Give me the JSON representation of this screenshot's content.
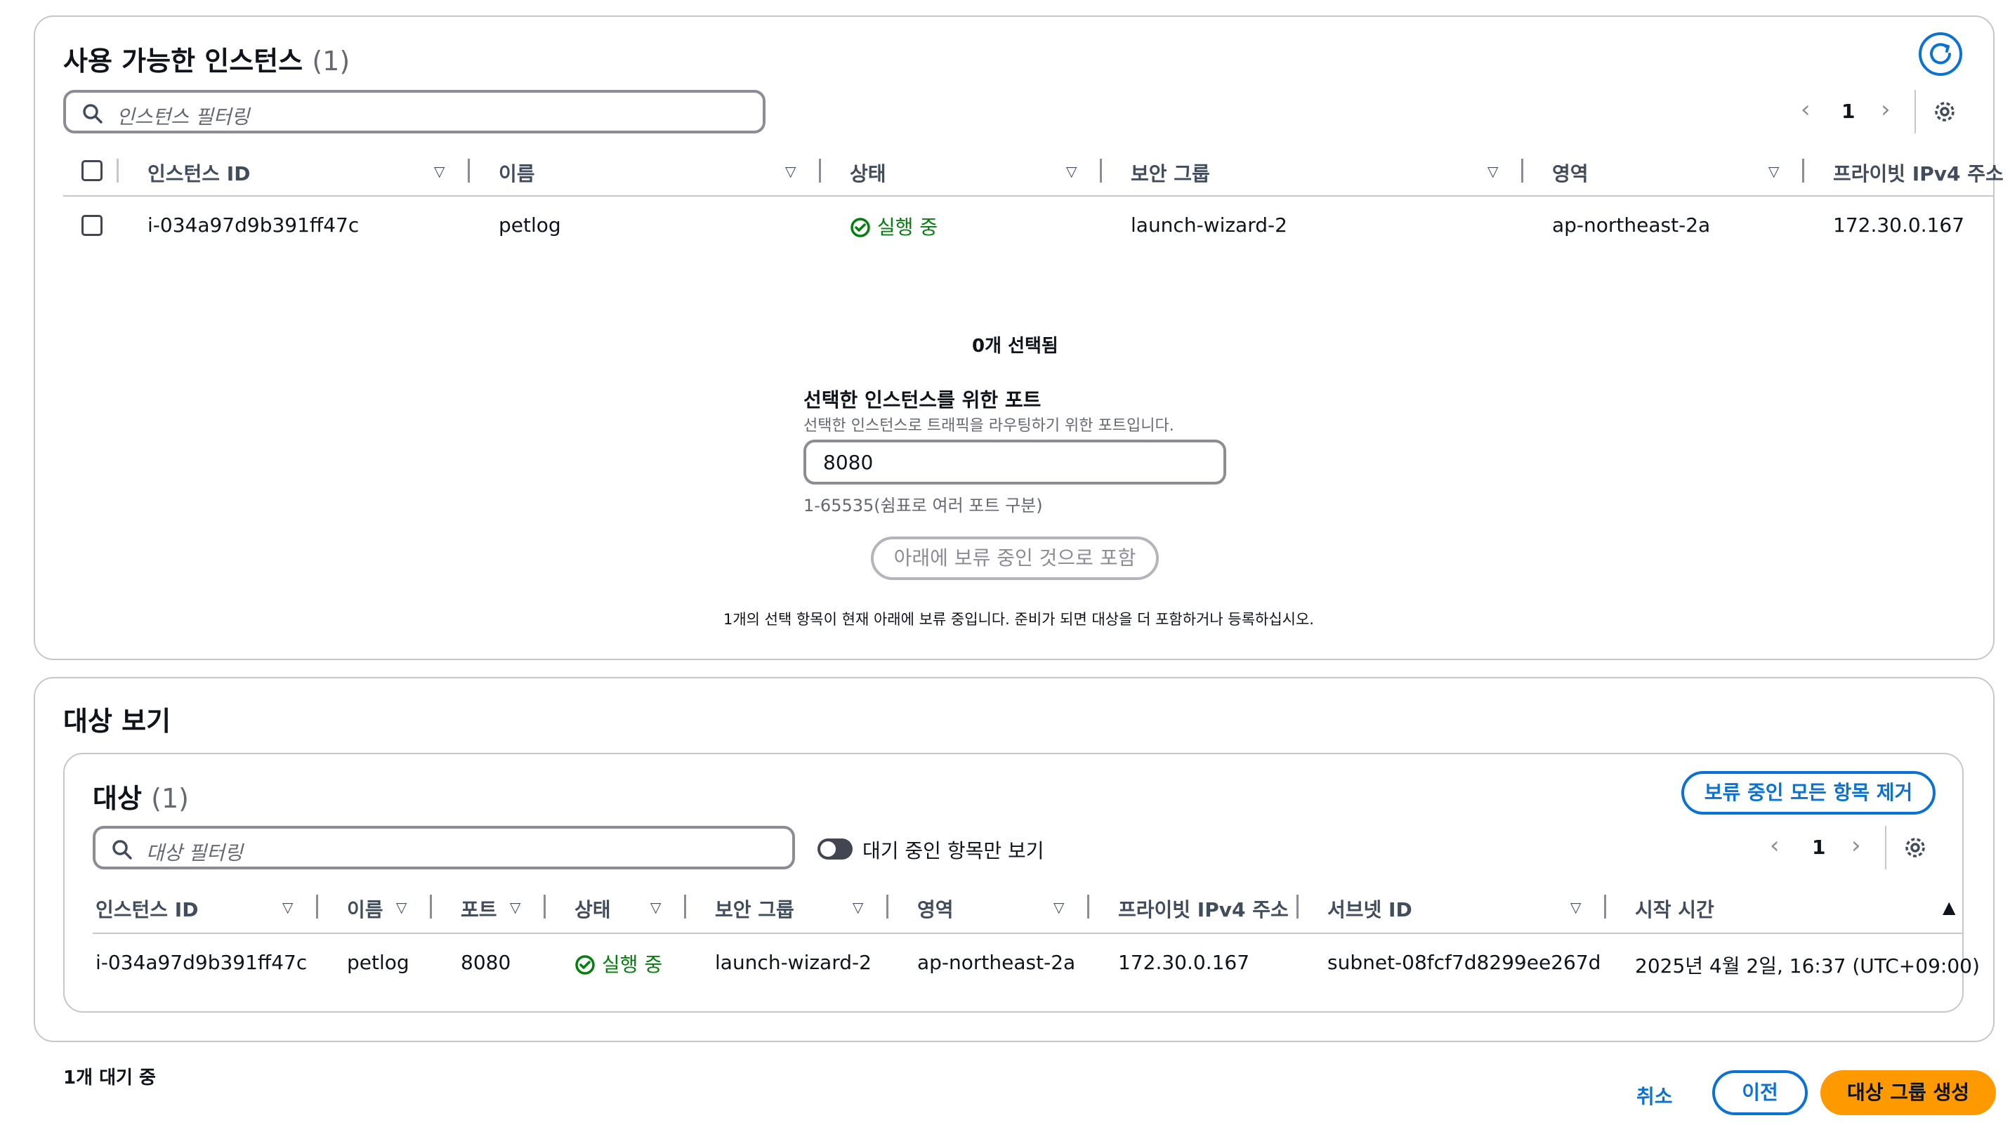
{
  "available": {
    "title": "사용 가능한 인스턴스",
    "count": "(1)",
    "filter_placeholder": "인스턴스 필터링",
    "page": "1",
    "columns": [
      "인스턴스 ID",
      "이름",
      "상태",
      "보안 그룹",
      "영역",
      "프라이빗 IPv4 주소"
    ],
    "rows": [
      {
        "id": "i-034a97d9b391ff47c",
        "name": "petlog",
        "state": "실행 중",
        "sg": "launch-wizard-2",
        "zone": "ap-northeast-2a",
        "ip": "172.30.0.167"
      }
    ]
  },
  "selection": {
    "selected_text": "0개 선택됨",
    "port_label": "선택한 인스턴스를 위한 포트",
    "port_desc": "선택한 인스턴스로 트래픽을 라우팅하기 위한 포트입니다.",
    "port_value": "8080",
    "port_hint": "1-65535(쉼표로 여러 포트 구분)",
    "include_button": "아래에 보류 중인 것으로 포함",
    "pending_note": "1개의 선택 항목이 현재 아래에 보류 중입니다. 준비가 되면 대상을 더 포함하거나 등록하십시오."
  },
  "review": {
    "title": "대상 보기",
    "targets_title": "대상",
    "targets_count": "(1)",
    "remove_all_button": "보류 중인 모든 항목 제거",
    "filter_placeholder": "대상 필터링",
    "toggle_label": "대기 중인 항목만 보기",
    "page": "1",
    "columns": [
      "인스턴스 ID",
      "이름",
      "포트",
      "상태",
      "보안 그룹",
      "영역",
      "프라이빗 IPv4 주소",
      "서브넷 ID",
      "시작 시간"
    ],
    "rows": [
      {
        "id": "i-034a97d9b391ff47c",
        "name": "petlog",
        "port": "8080",
        "state": "실행 중",
        "sg": "launch-wizard-2",
        "zone": "ap-northeast-2a",
        "ip": "172.30.0.167",
        "subnet": "subnet-08fcf7d8299ee267d",
        "launch": "2025년 4월 2일, 16:37 (UTC+09:00)"
      }
    ]
  },
  "footer": {
    "pending_count": "1개 대기 중",
    "cancel": "취소",
    "previous": "이전",
    "create": "대상 그룹 생성"
  },
  "colors": {
    "accent": "#0972d3",
    "success": "#037f0c",
    "primary_button": "#ff9900",
    "border": "#c6c6cd"
  },
  "icons": [
    "refresh-icon",
    "search-icon",
    "settings-icon",
    "chevron-left-icon",
    "chevron-right-icon",
    "sort-down-icon",
    "sort-up-icon",
    "status-success-icon",
    "toggle-switch"
  ]
}
